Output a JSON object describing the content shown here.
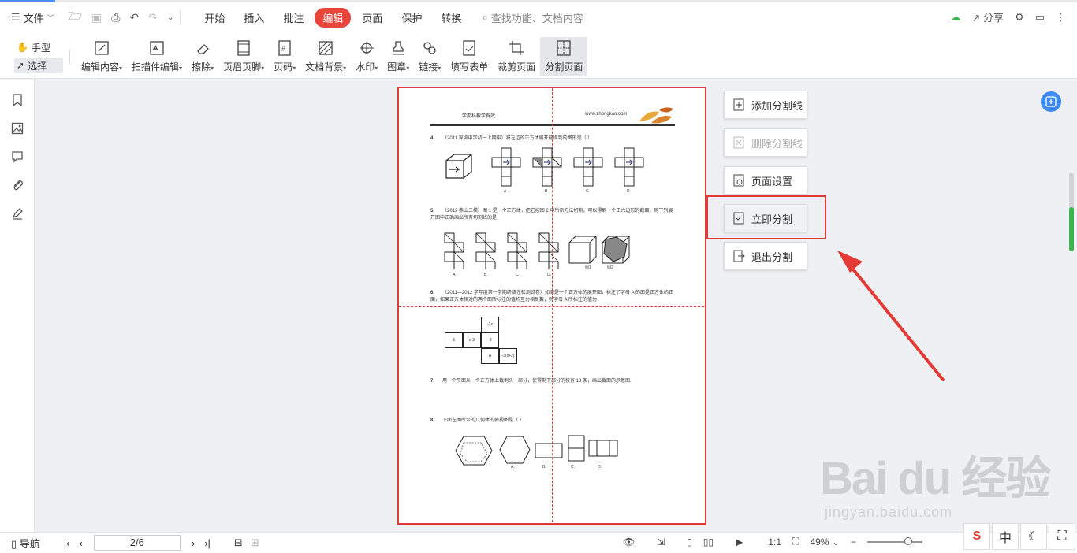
{
  "menu": {
    "file_label": "文件",
    "tabs": [
      "开始",
      "插入",
      "批注",
      "编辑",
      "页面",
      "保护",
      "转换"
    ],
    "active_tab": "编辑",
    "search_placeholder": "查找功能、文档内容",
    "share_label": "分享"
  },
  "toolbar": {
    "hand_label": "手型",
    "select_label": "选择",
    "items": [
      {
        "label": "编辑内容",
        "dropdown": true,
        "icon": "edit-content-icon"
      },
      {
        "label": "扫描件编辑",
        "dropdown": true,
        "icon": "scan-edit-icon"
      },
      {
        "label": "擦除",
        "dropdown": true,
        "icon": "eraser-icon"
      },
      {
        "label": "页眉页脚",
        "dropdown": true,
        "icon": "header-footer-icon"
      },
      {
        "label": "页码",
        "dropdown": true,
        "icon": "page-number-icon"
      },
      {
        "label": "文档背景",
        "dropdown": true,
        "icon": "doc-background-icon"
      },
      {
        "label": "水印",
        "dropdown": true,
        "icon": "watermark-icon"
      },
      {
        "label": "图章",
        "dropdown": true,
        "icon": "stamp-icon"
      },
      {
        "label": "链接",
        "dropdown": true,
        "icon": "link-icon"
      },
      {
        "label": "填写表单",
        "dropdown": false,
        "icon": "form-icon"
      },
      {
        "label": "裁剪页面",
        "dropdown": false,
        "icon": "crop-icon"
      },
      {
        "label": "分割页面",
        "dropdown": false,
        "icon": "split-page-icon"
      }
    ],
    "active": "分割页面"
  },
  "split_panel": {
    "add": "添加分割线",
    "delete": "删除分割线",
    "page_setup": "页面设置",
    "split_now": "立即分割",
    "exit": "退出分割"
  },
  "document": {
    "header_left": "学而科教学有效",
    "header_right": "www.zhongkao.com",
    "q4_num": "4.",
    "q4_text": "（2011 深圳中学初一上期中）将左边的正方体展开能得到的图形是（      ）",
    "q4_options": [
      "A",
      "B",
      "C",
      "D"
    ],
    "q5_num": "5.",
    "q5_text": "（2012 燕山二模）图 1 是一个正方体，把它按图 2 中所示方法切割，可以得到一个正六边形的截面，则下列展开图中正确画出所有切割线的是",
    "q5_options": [
      "A.",
      "B.",
      "C.",
      "D."
    ],
    "q5_fig_labels": [
      "图1",
      "图2"
    ],
    "q6_num": "6.",
    "q6_text": "（2011—2012 学年度第一学期终结性检测试卷）如图是一个正方体的展开图，标注了字母 A 的面是正方体的正面，如果正方体相对的两个面所标注的值均互为相反数，则字母 A 所标注的值为",
    "q6_cells": [
      "-2x",
      "3",
      "x-3",
      "-3",
      "A",
      "-3(x+2)"
    ],
    "q7_num": "7.",
    "q7_text": "用一个平面从一个正方体上截到头一部分，使得剩下部分的棱有 13 条，画出截面的示意图.",
    "q8_num": "8.",
    "q8_text": "下面左图所示的几何体的俯视图是（      ）",
    "q8_options": [
      "A.",
      "B.",
      "C.",
      "D."
    ]
  },
  "status": {
    "nav_label": "导航",
    "page_indicator": "2/6",
    "zoom": "49%",
    "zoom_level": 0.75,
    "view_ratio": "1:1"
  },
  "ime": {
    "lang": "中"
  },
  "watermark": {
    "text": "Bai du 经验",
    "url": "jingyan.baidu.com"
  },
  "colors": {
    "accent_red": "#e8463b",
    "highlight_red": "#e53935",
    "scroll_green": "#3cb44b",
    "brand_blue": "#3d8bf2"
  }
}
